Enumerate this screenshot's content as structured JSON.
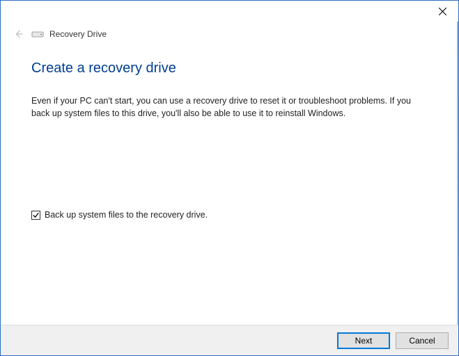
{
  "window": {
    "title": "Recovery Drive"
  },
  "page": {
    "heading": "Create a recovery drive",
    "description": "Even if your PC can't start, you can use a recovery drive to reset it or troubleshoot problems. If you back up system files to this drive, you'll also be able to use it to reinstall Windows."
  },
  "options": {
    "backup_checkbox_label": "Back up system files to the recovery drive.",
    "backup_checked": true
  },
  "buttons": {
    "next": "Next",
    "cancel": "Cancel"
  }
}
